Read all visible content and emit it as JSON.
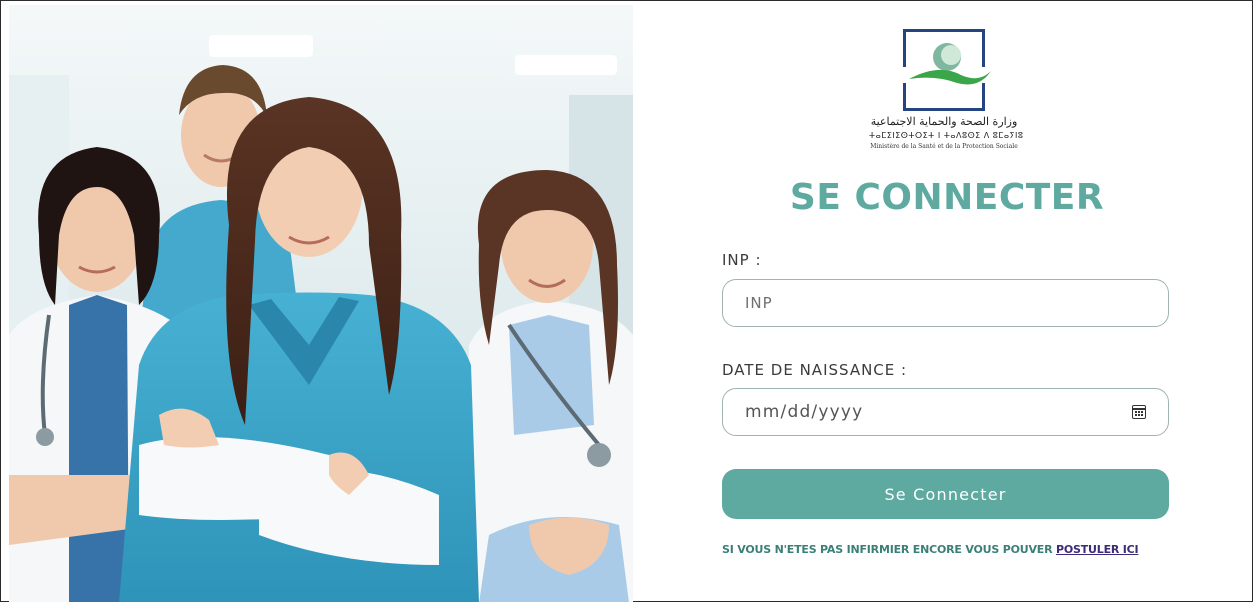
{
  "logo": {
    "arabic_name": "وزارة الصحة والحماية الاجتماعية",
    "tifinagh_name": "ⵜⴰⵎⵉⵏⵉⵙⵜⵔⵉⵜ ⵏ ⵜⴰⴷⵓⵙⵉ ⴷ ⵓⵎⴰⵢⵏⵓ",
    "french_name": "Ministère de la Santé et de la Protection Sociale",
    "colors": {
      "frame": "#24457f",
      "swoosh": "#3aa64a",
      "circle": "#7fb7a0"
    }
  },
  "form": {
    "title": "SE CONNECTER",
    "inp_label": "INP :",
    "inp_placeholder": "INP",
    "dob_label": "DATE DE NAISSANCE :",
    "dob_placeholder": "mm/dd/yyyy",
    "calendar_icon": "calendar-icon",
    "submit_label": "Se Connecter"
  },
  "footer": {
    "prompt": "SI VOUS N'ETES PAS INFIRMIER ENCORE VOUS POUVER ",
    "link_label": "POSTULER ICI"
  },
  "colors": {
    "accent": "#5ea9a0",
    "link": "#3e2a7a",
    "scrub_blue": "#3fa6c7"
  }
}
